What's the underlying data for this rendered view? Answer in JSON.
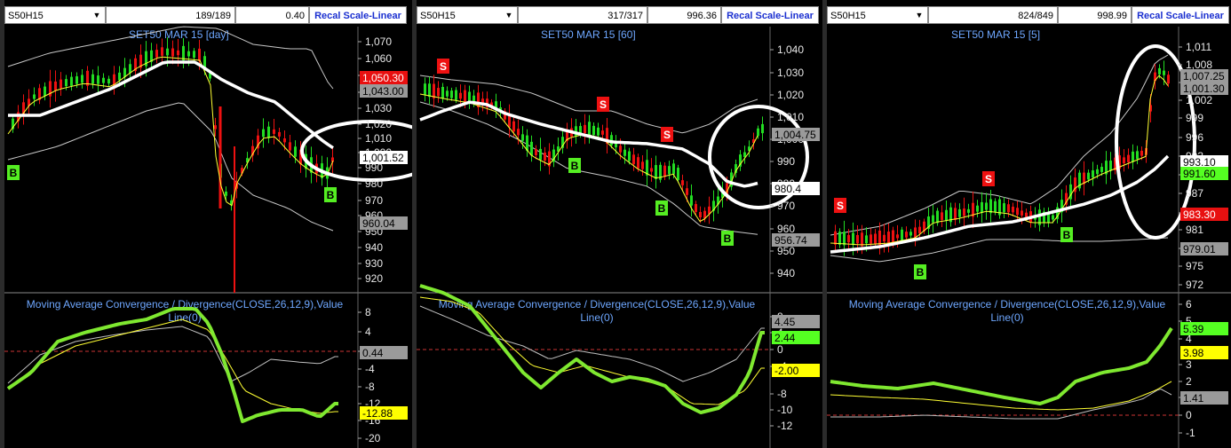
{
  "colors": {
    "background": "#000000",
    "candle_up": "#22dd22",
    "candle_down": "#ee1111",
    "ma_slow": "#ffffff",
    "ma_fast": "#ffff33",
    "band": "#c8c8c8",
    "macd_line": "#7fe830",
    "signal_line": "#ffff33",
    "zero_line": "#cc3333",
    "buy_marker": "#55ee22",
    "sell_marker": "#ee1111",
    "title_text": "#6ea7ff"
  },
  "panels": [
    {
      "symbol": "S50H15",
      "bar_count": "189/189",
      "value": "0.40",
      "recal_label": "Recal Scale-Linear",
      "title": "SET50 MAR 15   [day]",
      "indicator_title": "Moving Average Convergence / Divergence(CLOSE,26,12,9),Value Line(0)",
      "price_ticks": [
        "1,070",
        "1,060",
        "1,050",
        "1,040",
        "1,030",
        "1,020",
        "1,010",
        "1,000",
        "990",
        "980",
        "970",
        "960",
        "950",
        "940",
        "930",
        "920"
      ],
      "price_tags": [
        {
          "text": "1,050.30",
          "color": "red"
        },
        {
          "text": "1,043.00",
          "color": "gray"
        },
        {
          "text": "1,001.52",
          "color": "white"
        },
        {
          "text": "960.04",
          "color": "gray"
        }
      ],
      "macd_ticks": [
        "8",
        "4",
        "0",
        "-4",
        "-8",
        "-12",
        "-16",
        "-20"
      ],
      "macd_tags": [
        {
          "text": "0.44",
          "color": "gray"
        },
        {
          "text": "-12.88",
          "color": "yellow"
        }
      ],
      "signals": [
        {
          "label": "B",
          "type": "buy"
        },
        {
          "label": "B",
          "type": "buy"
        }
      ]
    },
    {
      "symbol": "S50H15",
      "bar_count": "317/317",
      "value": "996.36",
      "recal_label": "Recal Scale-Linear",
      "title": "SET50 MAR 15   [60]",
      "indicator_title": "Moving Average Convergence / Divergence(CLOSE,26,12,9),Value Line(0)",
      "price_ticks": [
        "1,040",
        "1,030",
        "1,020",
        "1,010",
        "1,000",
        "990",
        "980",
        "970",
        "960",
        "950",
        "940"
      ],
      "price_tags": [
        {
          "text": "1,004.75",
          "color": "gray"
        },
        {
          "text": "980.4",
          "color": "white"
        },
        {
          "text": "956.74",
          "color": "gray"
        }
      ],
      "macd_ticks": [
        "8",
        "4",
        "0",
        "-4",
        "-8",
        "-10",
        "-12"
      ],
      "macd_tags": [
        {
          "text": "4.45",
          "color": "gray"
        },
        {
          "text": "2.44",
          "color": "green"
        },
        {
          "text": "-2.00",
          "color": "yellow"
        }
      ],
      "signals": [
        {
          "label": "S",
          "type": "sell"
        },
        {
          "label": "S",
          "type": "sell"
        },
        {
          "label": "S",
          "type": "sell"
        },
        {
          "label": "B",
          "type": "buy"
        },
        {
          "label": "B",
          "type": "buy"
        },
        {
          "label": "B",
          "type": "buy"
        }
      ]
    },
    {
      "symbol": "S50H15",
      "bar_count": "824/849",
      "value": "998.99",
      "recal_label": "Recal Scale-Linear",
      "title": "SET50 MAR 15   [5]",
      "indicator_title": "Moving Average Convergence / Divergence(CLOSE,26,12,9),Value Line(0)",
      "price_ticks": [
        "1,011",
        "1,008",
        "1,005",
        "1,002",
        "999",
        "996",
        "993",
        "990",
        "987",
        "984",
        "981",
        "978",
        "975",
        "972"
      ],
      "price_tags": [
        {
          "text": "1,007.25",
          "color": "gray"
        },
        {
          "text": "1,001.30",
          "color": "gray"
        },
        {
          "text": "993.10",
          "color": "white"
        },
        {
          "text": "991.60",
          "color": "green"
        },
        {
          "text": "983.30",
          "color": "red"
        },
        {
          "text": "979.01",
          "color": "gray"
        }
      ],
      "macd_ticks": [
        "6",
        "5",
        "4",
        "3",
        "2",
        "1",
        "0",
        "-1"
      ],
      "macd_tags": [
        {
          "text": "5.39",
          "color": "green"
        },
        {
          "text": "3.98",
          "color": "yellow"
        },
        {
          "text": "1.41",
          "color": "gray"
        }
      ],
      "signals": [
        {
          "label": "S",
          "type": "sell"
        },
        {
          "label": "S",
          "type": "sell"
        },
        {
          "label": "B",
          "type": "buy"
        },
        {
          "label": "B",
          "type": "buy"
        }
      ]
    }
  ]
}
